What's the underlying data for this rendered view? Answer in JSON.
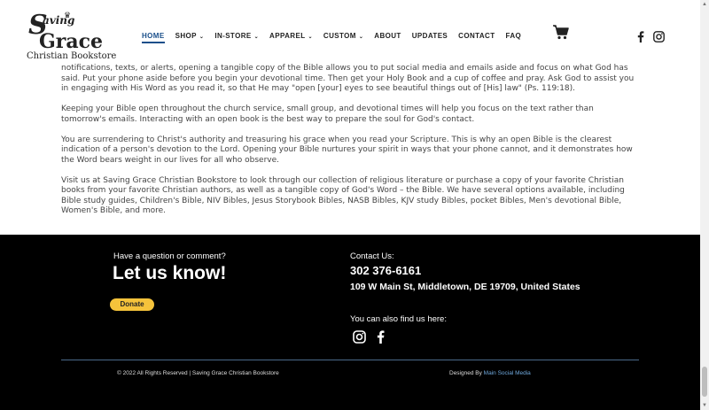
{
  "logo": {
    "line1": "S",
    "line2": "aving",
    "line3": "Grace",
    "line4": "Christian Bookstore",
    "crown": "♛"
  },
  "nav": {
    "items": [
      {
        "label": "HOME"
      },
      {
        "label": "SHOP"
      },
      {
        "label": "IN-STORE"
      },
      {
        "label": "APPAREL"
      },
      {
        "label": "CUSTOM"
      },
      {
        "label": "ABOUT"
      },
      {
        "label": "UPDATES"
      },
      {
        "label": "CONTACT"
      },
      {
        "label": "FAQ"
      }
    ],
    "chevron": "⌄"
  },
  "icons": {
    "cart": "cart-icon",
    "facebook": "facebook-icon",
    "instagram": "instagram-icon"
  },
  "article": {
    "p1": "notifications, texts, or alerts, opening a tangible copy of the Bible allows you to put social media and emails aside and focus on what God has said. Put your phone aside before you begin your devotional time. Then get your Holy Book and a cup of coffee and pray. Ask God to assist you in engaging with His Word as you read it, so that He may \"open [your] eyes to see beautiful things out of [His] law\" (Ps. 119:18).",
    "p2": "Keeping your Bible open throughout the church service, small group, and devotional times will help you focus on the text rather than tomorrow's emails. Interacting with an open book is the best way to prepare the soul for God's contact.",
    "p3": "You are surrendering to Christ's authority and treasuring his grace when you read your Scripture. This is why an open Bible is the clearest indication of a person's devotion to the Lord. Opening your Bible nurtures your spirit in ways that your phone cannot, and it demonstrates how the Word bears weight in our lives for all who observe.",
    "p4": "Visit us at Saving Grace Christian Bookstore to look through our collection of religious literature or purchase a copy of your favorite Christian books from your favorite Christian authors, as well as a tangible copy of God's Word – the Bible. We have several options available, including Bible study guides, Children's Bible, NIV Bibles, Jesus Storybook Bibles, NASB Bibles, KJV study Bibles, pocket Bibles, Men's devotional Bible, Women's Bible, and more."
  },
  "footer": {
    "question": "Have a question or comment?",
    "let_us_know": "Let us know!",
    "donate": "Donate",
    "contact_label": "Contact Us:",
    "phone": "302 376-6161",
    "address": "109 W Main St, Middletown, DE 19709, United States",
    "find_us": "You can also find us here:",
    "copyright": "© 2022 All Rights Reserved | Saving Grace Christian Bookstore",
    "designed_by": "Designed By ",
    "designer": "Main Social Media"
  },
  "colors": {
    "accent": "#1a4f8a",
    "footer_bg": "#000000",
    "donate": "#f5c33b",
    "link": "#6fa8dc"
  }
}
